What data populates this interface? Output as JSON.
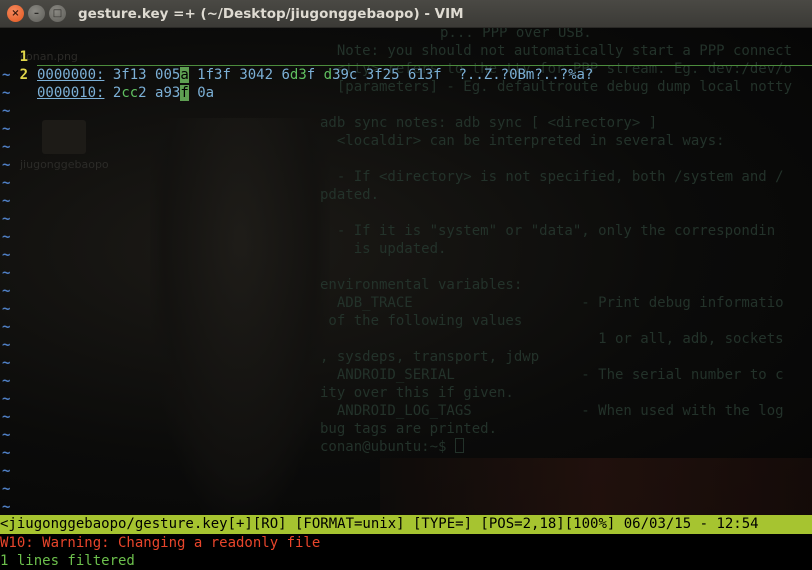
{
  "window": {
    "title": "gesture.key =+ (~/Desktop/jiugonggebaopo) - VIM",
    "buttons": {
      "close": "×",
      "minimize": "–",
      "maximize": "□"
    }
  },
  "desktop": {
    "icons": [
      {
        "label": "conan.png"
      },
      {
        "label": "jiugonggebaopo"
      }
    ]
  },
  "background_terminal": {
    "lines": [
      "  Note: you should not automatically start a PPP connect",
      "  <tty> refers to the tty for PPP stream. Eg. dev:/dev/o",
      "  [parameters] - Eg. defaultroute debug dump local notty",
      "",
      "adb sync notes: adb sync [ <directory> ]",
      "  <localdir> can be interpreted in several ways:",
      "",
      "  - If <directory> is not specified, both /system and /",
      "pdated.",
      "",
      "  - If it is \"system\" or \"data\", only the correspondin",
      "    is updated.",
      "",
      "environmental variables:",
      "  ADB_TRACE                    - Print debug informatio",
      " of the following values",
      "                                 1 or all, adb, sockets",
      ", sysdeps, transport, jdwp",
      "  ANDROID_SERIAL               - The serial number to c",
      "ity over this if given.",
      "  ANDROID_LOG_TAGS             - When used with the log",
      "bug tags are printed.",
      "conan@ubuntu:~$ "
    ],
    "partial_top": "p... PPP over USB."
  },
  "buffer": {
    "lines": [
      {
        "number": "1",
        "address": "0000000:",
        "hex_before": "3f13 005",
        "cursor_char": "a",
        "hex_after": " 1f3f 3042 6",
        "hex_hl1": "d3",
        "hex_mid1": "f ",
        "hex_hl2": "d",
        "hex_mid2": "39c 3f25 613f",
        "ascii": "  ?..Z.?0Bm?..?%a?"
      },
      {
        "number": "2",
        "address": "0000010:",
        "hex_before": "2",
        "hex_hl1": "cc",
        "hex_mid1": "2 a93",
        "cursor_char": "f",
        "hex_after": " 0a",
        "ascii": "                                  ,..?."
      }
    ],
    "tilde": "~"
  },
  "statusline": "<jiugonggebaopo/gesture.key[+][RO] [FORMAT=unix] [TYPE=] [POS=2,18][100%] 06/03/15 - 12:54",
  "warning": "W10: Warning: Changing a readonly file",
  "message": "1 lines filtered"
}
